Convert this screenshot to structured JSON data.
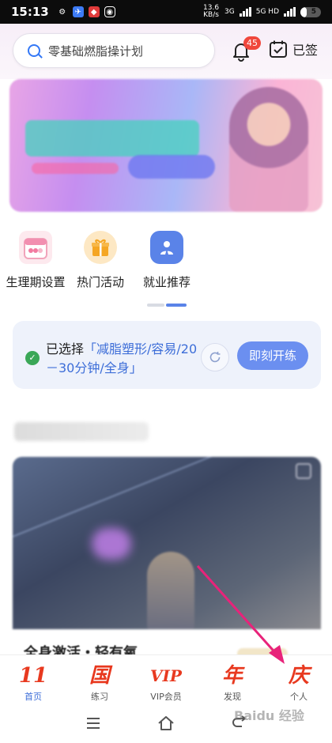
{
  "status": {
    "time": "15:13",
    "net_speed": "13.6 KB/s",
    "sim1": "3G",
    "sim2": "5G HD",
    "battery_level": "5"
  },
  "header": {
    "search_placeholder": "零基础燃脂操计划",
    "notification_count": "45",
    "checkin_label": "已签"
  },
  "shortcuts": [
    {
      "label": "生理期设置",
      "icon": "calendar-icon"
    },
    {
      "label": "热门活动",
      "icon": "gift-icon"
    },
    {
      "label": "就业推荐",
      "icon": "person-badge-icon"
    }
  ],
  "plan": {
    "prefix": "已选择",
    "selection": "「减脂塑形/容易/20－30分钟/全身」",
    "start_button": "即刻开练"
  },
  "video": {
    "title": "全身激活・轻有氧"
  },
  "tabs": [
    {
      "icon_glyph": "11",
      "label": "首页",
      "active": true
    },
    {
      "icon_glyph": "国",
      "label": "练习",
      "active": false
    },
    {
      "icon_glyph": "VIP",
      "label": "VIP会员",
      "active": false
    },
    {
      "icon_glyph": "年",
      "label": "发现",
      "active": false
    },
    {
      "icon_glyph": "庆",
      "label": "个人",
      "active": false
    }
  ],
  "watermark": "Baidu 经验",
  "colors": {
    "accent": "#3d6ed8",
    "tab_icon": "#e8391f",
    "arrow": "#e8237a",
    "start_button": "#6b8ff0"
  }
}
